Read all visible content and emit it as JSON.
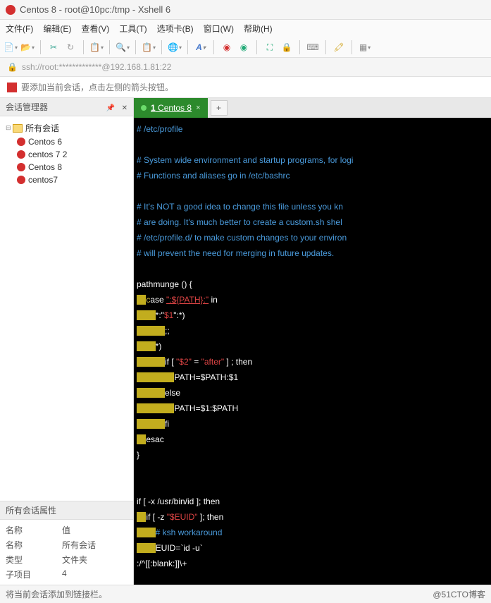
{
  "window": {
    "title": "Centos 8 - root@10pc:/tmp - Xshell 6"
  },
  "menu": {
    "file": "文件(F)",
    "edit": "编辑(E)",
    "view": "查看(V)",
    "tools": "工具(T)",
    "tabs": "选项卡(B)",
    "window": "窗口(W)",
    "help": "帮助(H)"
  },
  "addr": {
    "text": "ssh://root:*************@192.168.1.81:22"
  },
  "hint": {
    "text": "要添加当前会话，点击左侧的箭头按钮。"
  },
  "sidebar": {
    "sessions_title": "会话管理器",
    "root_name": "所有会话",
    "items": [
      {
        "label": "Centos 6"
      },
      {
        "label": "centos 7 2"
      },
      {
        "label": "Centos 8"
      },
      {
        "label": "centos7"
      }
    ],
    "props_title": "所有会话属性",
    "props_cols": {
      "name": "名称",
      "value": "值"
    },
    "props": [
      {
        "k": "名称",
        "v": "所有会话"
      },
      {
        "k": "类型",
        "v": "文件夹"
      },
      {
        "k": "子项目",
        "v": "4"
      }
    ]
  },
  "tab": {
    "number": "1",
    "label": "Centos 8"
  },
  "add_tab": "+",
  "term": {
    "l1": "# /etc/profile",
    "l2": "",
    "l3": "# System wide environment and startup programs, for logi",
    "l4": "# Functions and aliases go in /etc/bashrc",
    "l5": "",
    "l6": "# It's NOT a good idea to change this file unless you kn",
    "l7": "# are doing. It's much better to create a custom.sh shel",
    "l8": "# /etc/profile.d/ to make custom changes to your environ",
    "l9": "# will prevent the need for merging in future updates.",
    "l10": "",
    "l11": "pathmunge () {",
    "l12a": "    ",
    "l12b": "c",
    "l12c": "ase ",
    "l12d": "\":${PATH}:\"",
    "l12e": " in",
    "l13a": "        ",
    "l13b": "*:\"",
    "l13c": "$1",
    "l13d": "\":*)",
    "l14a": "            ",
    "l14b": ";;",
    "l15a": "        ",
    "l15b": "*)",
    "l16a": "            ",
    "l16b": "if [ ",
    "l16c": "\"$2\"",
    "l16d": " = ",
    "l16e": "\"after\"",
    "l16f": " ] ; then",
    "l17a": "                ",
    "l17b": "PATH=$PATH:$1",
    "l18a": "            ",
    "l18b": "else",
    "l19a": "                ",
    "l19b": "PATH=$1:$PATH",
    "l20a": "            ",
    "l20b": "fi",
    "l21a": "    ",
    "l21b": "esac",
    "l22": "}",
    "l23": "",
    "l24": "",
    "l25": "if [ -x /usr/bin/id ]; then",
    "l26a": "    ",
    "l26b": "if [ -z ",
    "l26c": "\"$EUID\"",
    "l26d": " ]; then",
    "l27a": "        ",
    "l27b": "# ksh workaround",
    "l28a": "        ",
    "l28b": "EUID=`id -u`",
    "l29": ":/^[[:blank:]]\\+"
  },
  "status": {
    "left": "将当前会话添加到链接栏。",
    "right": "@51CTO博客"
  }
}
